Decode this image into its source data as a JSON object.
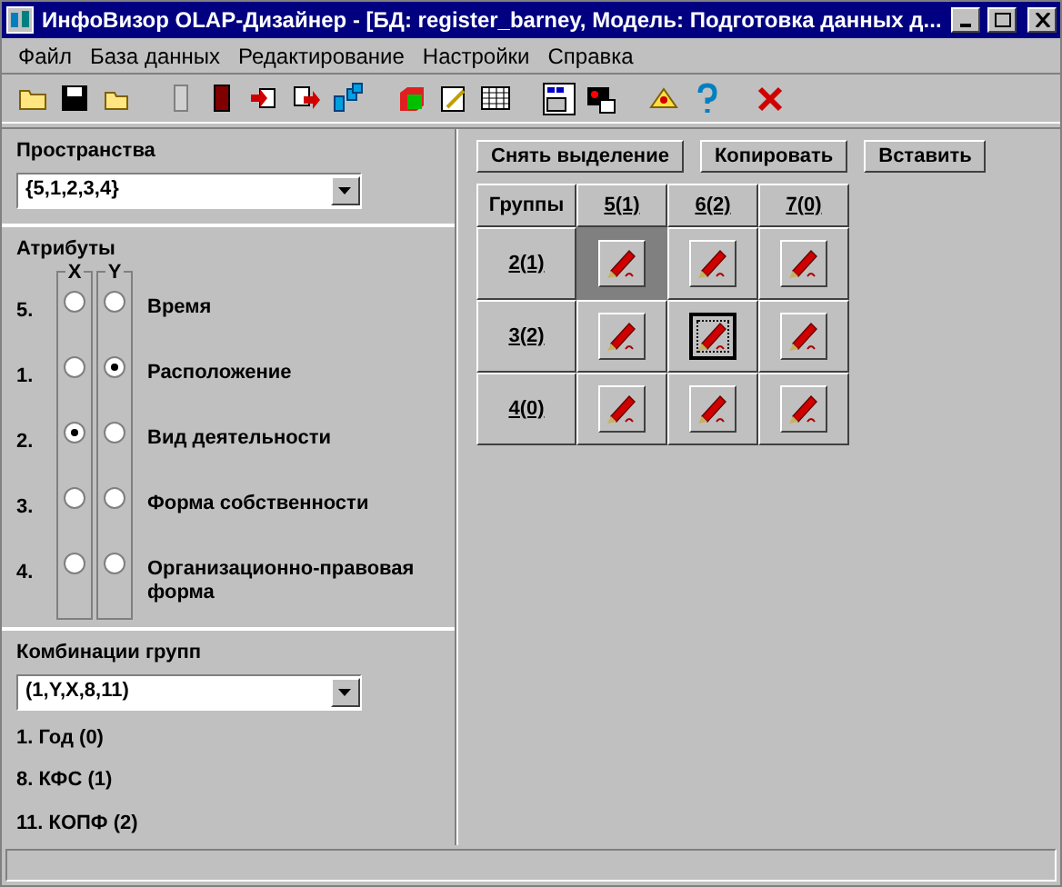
{
  "window": {
    "title": "ИнфоВизор OLAP-Дизайнер - [БД: register_barney, Модель: Подготовка данных д..."
  },
  "menu": [
    "Файл",
    "База данных",
    "Редактирование",
    "Настройки",
    "Справка"
  ],
  "spaces": {
    "label": "Пространства",
    "value": "{5,1,2,3,4}"
  },
  "attributes": {
    "label": "Атрибуты",
    "x_header": "X",
    "y_header": "Y",
    "items": [
      {
        "number": "5.",
        "name": "Время",
        "x": false,
        "y": false
      },
      {
        "number": "1.",
        "name": "Расположение",
        "x": false,
        "y": true
      },
      {
        "number": "2.",
        "name": "Вид деятельности",
        "x": true,
        "y": false
      },
      {
        "number": "3.",
        "name": "Форма собственности",
        "x": false,
        "y": false
      },
      {
        "number": "4.",
        "name": "Организационно-правовая форма",
        "x": false,
        "y": false
      }
    ]
  },
  "combinations": {
    "label": "Комбинации групп",
    "value": "(1,Y,X,8,11)",
    "items": [
      "1. Год (0)",
      "8. КФС (1)",
      "11. КОПФ (2)"
    ]
  },
  "buttons": [
    "Снять выделение",
    "Копировать",
    "Вставить"
  ],
  "grid": {
    "corner": "Группы",
    "columns": [
      "5(1)",
      "6(2)",
      "7(0)"
    ],
    "rows": [
      {
        "label": "2(1)",
        "cells": [
          {
            "selected": true,
            "focused": false
          },
          {
            "selected": false,
            "focused": false
          },
          {
            "selected": false,
            "focused": false
          }
        ]
      },
      {
        "label": "3(2)",
        "cells": [
          {
            "selected": false,
            "focused": false
          },
          {
            "selected": false,
            "focused": true
          },
          {
            "selected": false,
            "focused": false
          }
        ]
      },
      {
        "label": "4(0)",
        "cells": [
          {
            "selected": false,
            "focused": false
          },
          {
            "selected": false,
            "focused": false
          },
          {
            "selected": false,
            "focused": false
          }
        ]
      }
    ]
  }
}
